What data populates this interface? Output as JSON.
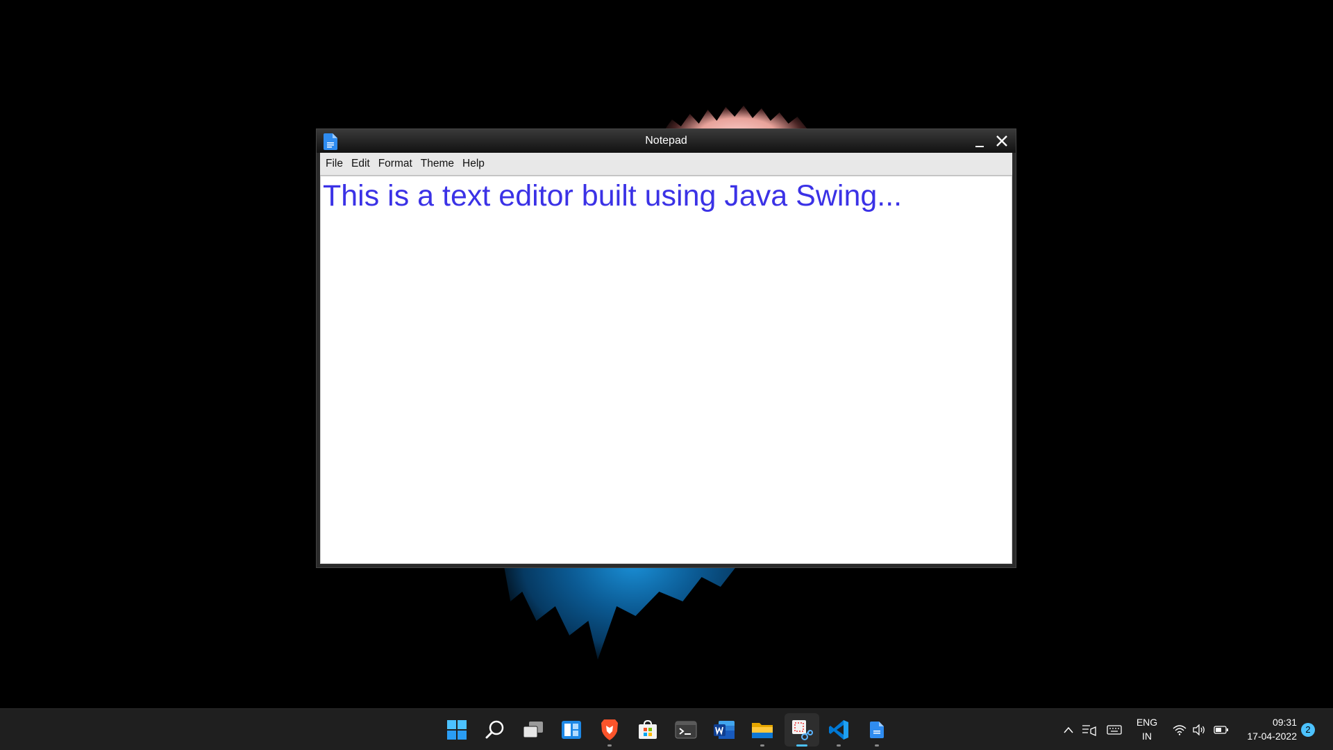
{
  "window": {
    "title": "Notepad",
    "menu": [
      "File",
      "Edit",
      "Format",
      "Theme",
      "Help"
    ],
    "content": "This is a text editor built using Java Swing...",
    "text_color": "#3b32e6"
  },
  "taskbar": {
    "apps": [
      "start-icon",
      "search-icon",
      "task-view-icon",
      "widgets-icon",
      "brave-browser-icon",
      "microsoft-store-icon",
      "terminal-icon",
      "word-icon",
      "file-explorer-icon",
      "snipping-tool-icon",
      "vscode-icon",
      "notepad-java-icon"
    ],
    "language": "ENG",
    "region": "IN",
    "time": "09:31",
    "date": "17-04-2022",
    "notifications": "2"
  }
}
